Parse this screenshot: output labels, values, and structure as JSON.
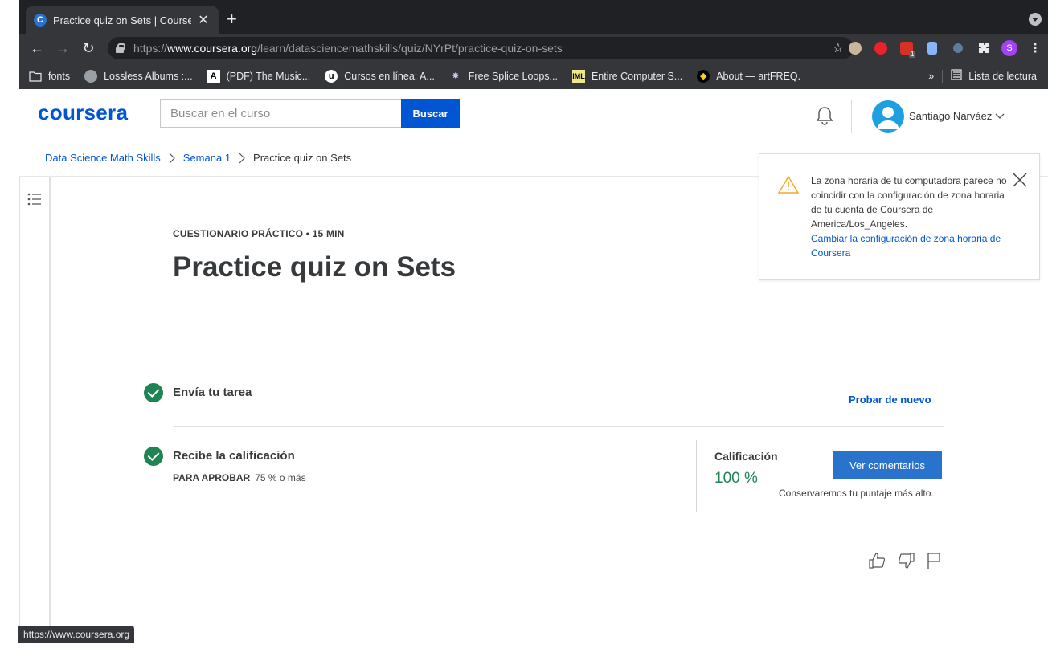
{
  "browser": {
    "tab_title": "Practice quiz on Sets | Courser",
    "tab_favicon_letter": "C",
    "url_prefix": "https://",
    "url_host": "www.coursera.org",
    "url_path": "/learn/datasciencemathskills/quiz/NYrPt/practice-quiz-on-sets",
    "profile_initial": "S",
    "ext_badge": "1",
    "bookmarks": [
      {
        "label": "fonts"
      },
      {
        "label": "Lossless Albums :..."
      },
      {
        "label": "(PDF) The Music..."
      },
      {
        "label": "Cursos en línea: A..."
      },
      {
        "label": "Free Splice Loops..."
      },
      {
        "label": "Entire Computer S..."
      },
      {
        "label": "About — artFREQ."
      }
    ],
    "bookmarks_overflow": "»",
    "reading_list": "Lista de lectura",
    "status_url": "https://www.coursera.org"
  },
  "header": {
    "logo": "coursera",
    "search_placeholder": "Buscar en el curso",
    "search_button": "Buscar",
    "user_name": "Santiago Narváez"
  },
  "breadcrumb": {
    "course": "Data Science Math Skills",
    "week": "Semana 1",
    "current": "Practice quiz on Sets"
  },
  "quiz": {
    "eyebrow": "CUESTIONARIO PRÁCTICO • 15 MIN",
    "title": "Practice quiz on Sets",
    "step1_label": "Envía tu tarea",
    "retry": "Probar de nuevo",
    "step2_label": "Recibe la calificación",
    "pass_label": "PARA APROBAR",
    "pass_value": "75 % o más",
    "grade_label": "Calificación",
    "grade_value": "100 %",
    "feedback_button": "Ver comentarios",
    "keep_note": "Conservaremos tu puntaje más alto."
  },
  "notice": {
    "text": "La zona horaria de tu computadora parece no coincidir con la configuración de zona horaria de tu cuenta de Coursera de America/Los_Angeles.",
    "link": "Cambiar la configuración de zona horaria de Coursera"
  },
  "colors": {
    "brand": "#0056d2",
    "success": "#1f8354",
    "warning": "#f5a623"
  }
}
